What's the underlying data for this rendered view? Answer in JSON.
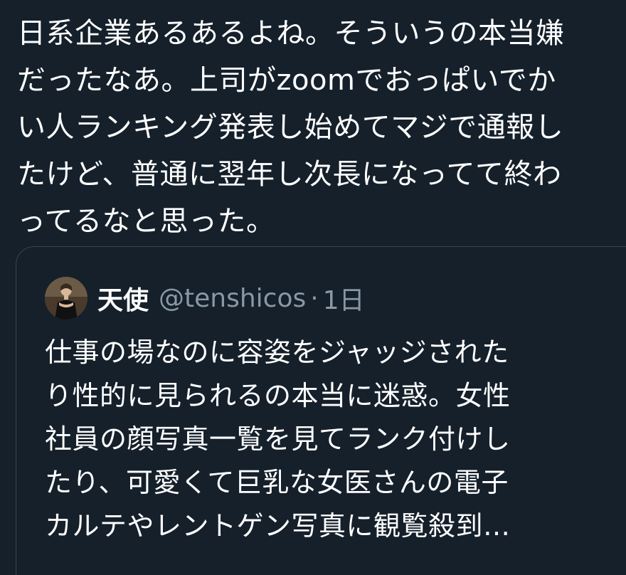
{
  "tweet": {
    "text": "日系企業あるあるよね。そういうの本当嫌\nだったなあ。上司がzoomでおっぱいでか\nい人ランキング発表し始めてマジで通報し\nたけど、普通に翌年し次長になってて終わ\nってるなと思った。"
  },
  "quote": {
    "author_name": "天使",
    "handle": "@tenshicos",
    "separator": "·",
    "time": "1日",
    "text": "仕事の場なのに容姿をジャッジされた\nり性的に見られるの本当に迷惑。女性\n社員の顔写真一覧を見てランク付けし\nたり、可愛くて巨乳な女医さんの電子\nカルテやレントゲン写真に観覧殺到…"
  },
  "colors": {
    "background": "#15202b",
    "text": "#ffffff",
    "secondary_text": "#8899a6",
    "card_border": "#38444d"
  },
  "icons": {
    "avatar": "user-avatar-photo"
  }
}
